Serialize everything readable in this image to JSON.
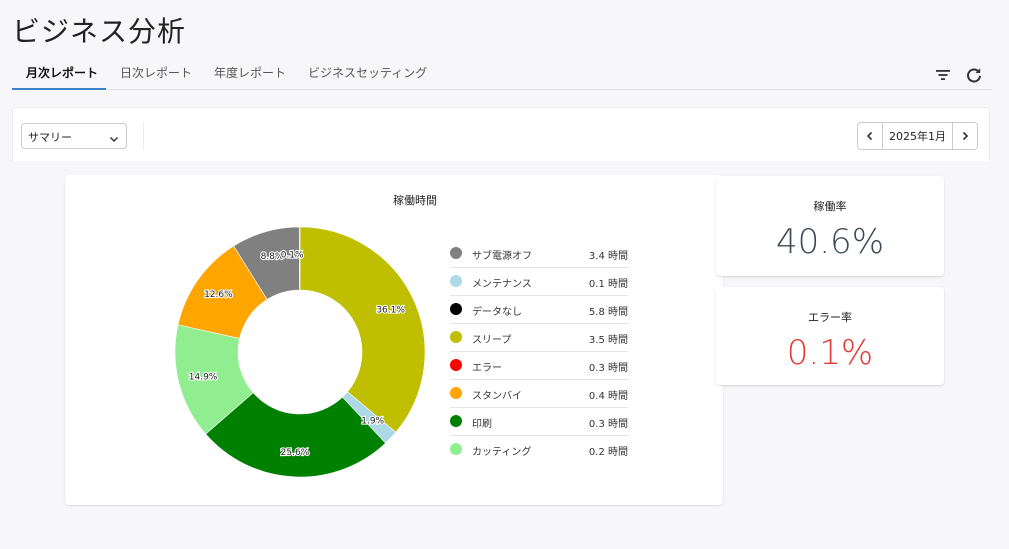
{
  "page": {
    "title": "ビジネス分析"
  },
  "tabs": [
    {
      "label": "月次レポート",
      "active": true
    },
    {
      "label": "日次レポート"
    },
    {
      "label": "年度レポート"
    },
    {
      "label": "ビジネスセッティング"
    }
  ],
  "toolbar": {
    "filter_icon": "filter-icon",
    "refresh_icon": "refresh-icon"
  },
  "filter": {
    "select_value": "サマリー"
  },
  "date_nav": {
    "value": "2025年1月"
  },
  "stats": {
    "uptime": {
      "title": "稼働率",
      "value": "40.6%"
    },
    "error": {
      "title": "エラー率",
      "value": "0.1%",
      "color": "#e53935"
    }
  },
  "chart_data": {
    "type": "pie",
    "title": "稼働時間",
    "center_hole": true,
    "slice_order": [
      "スリープ",
      "メンテナンス",
      "印刷",
      "カッティング",
      "スタンバイ",
      "サブ電源オフ",
      "エラー"
    ],
    "slices": [
      {
        "name": "スリープ",
        "percent": 36.1,
        "label": "36.1%",
        "color": "#bfbf00"
      },
      {
        "name": "メンテナンス",
        "percent": 1.9,
        "label": "1.9%",
        "color": "#add8e6"
      },
      {
        "name": "印刷",
        "percent": 25.6,
        "label": "25.6%",
        "color": "#008000"
      },
      {
        "name": "カッティング",
        "percent": 14.9,
        "label": "14.9%",
        "color": "#90ee90"
      },
      {
        "name": "スタンバイ",
        "percent": 12.6,
        "label": "12.6%",
        "color": "#ffa500"
      },
      {
        "name": "サブ電源オフ",
        "percent": 8.8,
        "label": "8.8%",
        "color": "#808080"
      },
      {
        "name": "エラー",
        "percent": 0.1,
        "label": "0.1%",
        "color": "#ff0000"
      }
    ],
    "legend": [
      {
        "label": "サブ電源オフ",
        "value": "3.4 時間",
        "color": "#808080"
      },
      {
        "label": "メンテナンス",
        "value": "0.1 時間",
        "color": "#add8e6"
      },
      {
        "label": "データなし",
        "value": "5.8 時間",
        "color": "#000000"
      },
      {
        "label": "スリープ",
        "value": "3.5 時間",
        "color": "#bfbf00"
      },
      {
        "label": "エラー",
        "value": "0.3 時間",
        "color": "#ff0000"
      },
      {
        "label": "スタンバイ",
        "value": "0.4 時間",
        "color": "#ffa500"
      },
      {
        "label": "印刷",
        "value": "0.3 時間",
        "color": "#008000"
      },
      {
        "label": "カッティング",
        "value": "0.2 時間",
        "color": "#90ee90"
      }
    ],
    "legend_placement": "right"
  }
}
